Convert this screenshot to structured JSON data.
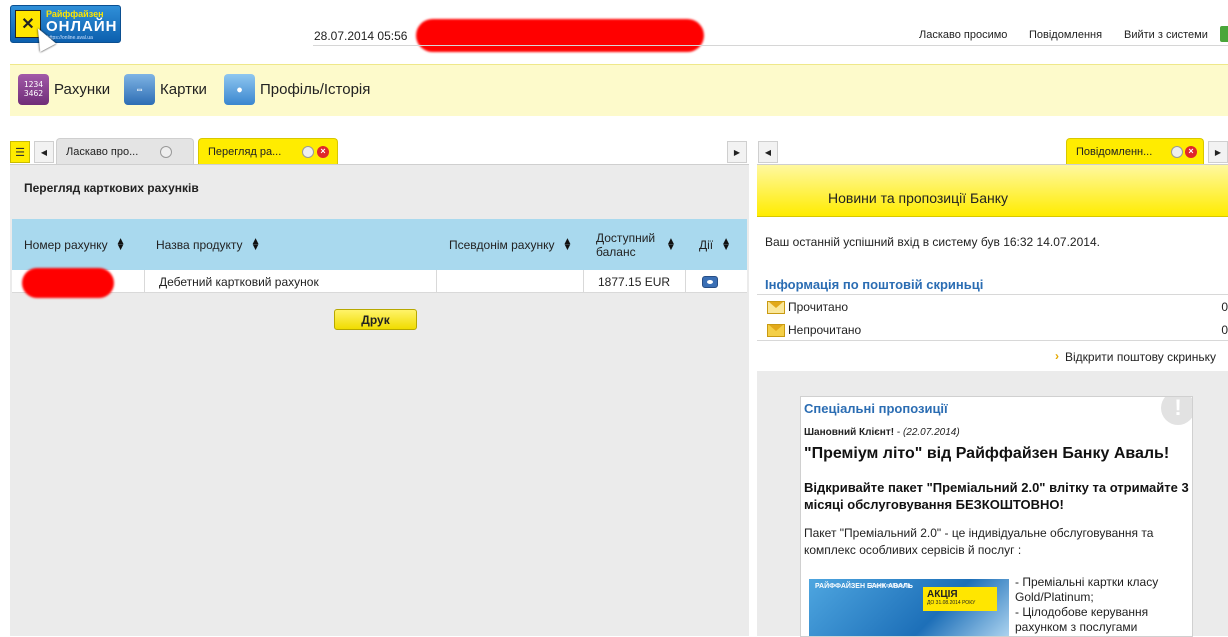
{
  "header": {
    "logo": {
      "line1": "Райффайзен",
      "line2": "ОНЛАЙН",
      "line3": "https://online.aval.ua"
    },
    "datetime": "28.07.2014 05:56",
    "links": [
      "Ласкаво просимо",
      "Повідомлення",
      "Вийти з системи"
    ]
  },
  "nav": [
    {
      "label": "Рахунки",
      "icon": "accounts-icon"
    },
    {
      "label": "Картки",
      "icon": "cards-icon"
    },
    {
      "label": "Профіль/Історія",
      "icon": "profile-icon"
    }
  ],
  "left_panel": {
    "tabs": [
      {
        "label": "Ласкаво про..."
      },
      {
        "label": "Перегляд ра..."
      }
    ],
    "section_title": "Перегляд карткових рахунків",
    "table": {
      "headers": [
        "Номер рахунку",
        "Назва продукту",
        "Псевдонім рахунку",
        "Доступний баланс",
        "Дії"
      ],
      "rows": [
        {
          "account": "",
          "product": "Дебетний картковий рахунок",
          "alias": "",
          "balance": "1877.15 EUR"
        }
      ]
    },
    "print_button": "Друк"
  },
  "right_panel": {
    "tab": "Повідомленн...",
    "news_title": "Новини та пропозиції Банку",
    "last_login": "Ваш останній успішний вхід в систему був 16:32 14.07.2014.",
    "mail_info_title": "Інформація по поштовій скриньці",
    "mail": [
      {
        "label": "Прочитано",
        "count": "0"
      },
      {
        "label": "Непрочитано",
        "count": "0"
      }
    ],
    "open_mailbox": "Відкрити поштову скриньку",
    "offers": {
      "title": "Спеціальні пропозиції",
      "from": "Шановний Клієнт!",
      "date": "(22.07.2014)",
      "headline": "\"Преміум літо\" від Райффайзен Банку Аваль!",
      "subheadline": "Відкривайте пакет \"Преміальний 2.0\" влітку та отримайте 3 місяці обслуговування БЕЗКОШТОВНО!",
      "paragraph": "Пакет \"Преміальний 2.0\" - це індивідуальне обслуговування та комплекс особливих сервісів й послуг :",
      "bullets": [
        "- Преміальні картки класу Gold/Platinum;",
        "- Цілодобове керування рахунком з послугами"
      ],
      "promo": {
        "brand": "РАЙФФАЙЗЕН БАНК АВАЛЬ",
        "premium": "Premium Banking",
        "badge_title": "АКЦІЯ",
        "badge_sub": "ДО 31.08.2014 РОКУ"
      }
    }
  }
}
